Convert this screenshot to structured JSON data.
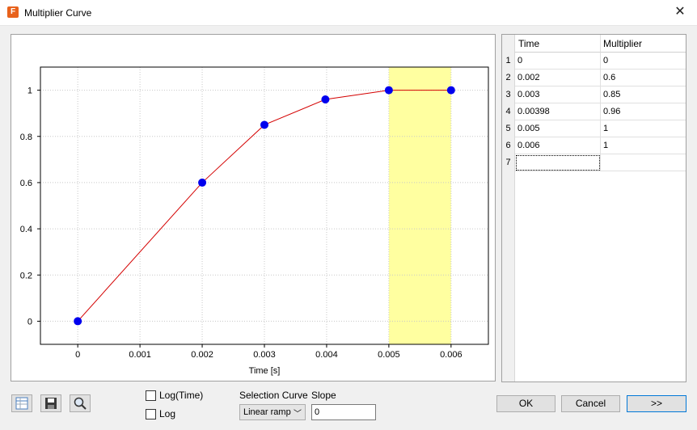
{
  "window": {
    "title": "Multiplier Curve",
    "app_icon_letter": "F"
  },
  "table": {
    "headers": [
      "Time",
      "Multiplier"
    ],
    "rows": [
      {
        "n": "1",
        "time": "0",
        "mult": "0"
      },
      {
        "n": "2",
        "time": "0.002",
        "mult": "0.6"
      },
      {
        "n": "3",
        "time": "0.003",
        "mult": "0.85"
      },
      {
        "n": "4",
        "time": "0.00398",
        "mult": "0.96"
      },
      {
        "n": "5",
        "time": "0.005",
        "mult": "1"
      },
      {
        "n": "6",
        "time": "0.006",
        "mult": "1"
      },
      {
        "n": "7",
        "time": "",
        "mult": ""
      }
    ]
  },
  "controls": {
    "log_time_label": "Log(Time)",
    "log_label": "Log",
    "selection_curve_label": "Selection Curve",
    "selection_curve_value": "Linear ramp",
    "slope_label": "Slope",
    "slope_value": "0"
  },
  "buttons": {
    "ok": "OK",
    "cancel": "Cancel",
    "next": ">>"
  },
  "toolbar_icons": [
    "table-icon",
    "save-icon",
    "zoom-icon"
  ],
  "chart_data": {
    "type": "line",
    "x": [
      0,
      0.002,
      0.003,
      0.00398,
      0.005,
      0.006
    ],
    "y": [
      0,
      0.6,
      0.85,
      0.96,
      1,
      1
    ],
    "xlabel": "Time [s]",
    "ylabel": "",
    "x_ticks": [
      "0",
      "0.001",
      "0.002",
      "0.003",
      "0.004",
      "0.005",
      "0.006"
    ],
    "y_ticks": [
      "0",
      "0.2",
      "0.4",
      "0.6",
      "0.8",
      "1"
    ],
    "xlim": [
      -0.0006,
      0.0066
    ],
    "ylim": [
      -0.1,
      1.1
    ],
    "grid": true,
    "highlight_x_range": [
      0.005,
      0.006
    ],
    "colors": {
      "line": "#d40000",
      "marker": "#0000ee",
      "highlight": "#ffffa0"
    }
  }
}
